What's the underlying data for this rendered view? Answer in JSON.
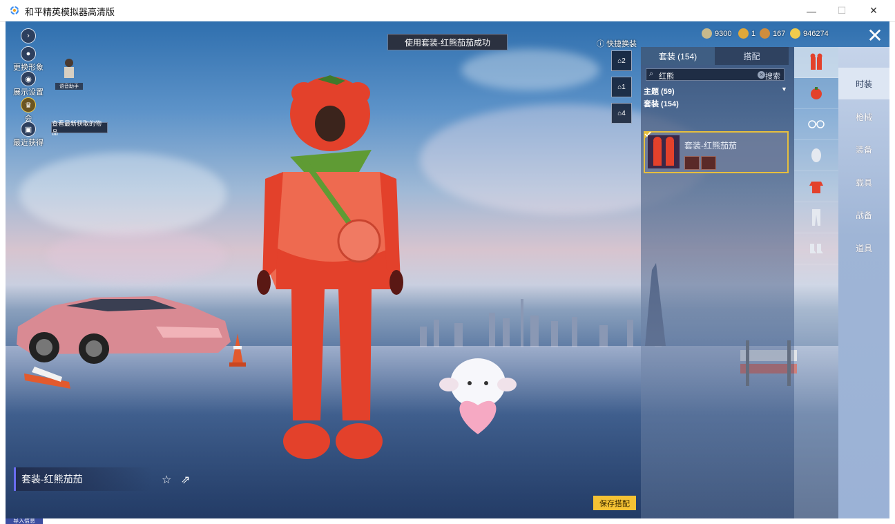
{
  "window": {
    "title": "和平精英模拟器高清版",
    "minimize": "—",
    "maximize": "☐",
    "close": "✕"
  },
  "left_menu": {
    "change_look": "更换形象",
    "display_settings": "展示设置",
    "vip": "会",
    "recent": "最近获得",
    "voice_assistant": "语音助手",
    "tooltip": "查看最新获取的物品"
  },
  "banner": "使用套装-红熊茄茄成功",
  "currencies": [
    {
      "value": "9300",
      "color": "#c7b98c"
    },
    {
      "value": "1",
      "color": "#e0a83a"
    },
    {
      "value": "167",
      "color": "#d08d3c"
    },
    {
      "value": "946274",
      "color": "#f0cb4c"
    }
  ],
  "quick_change": {
    "label": "快捷换装",
    "slots": [
      "2",
      "1",
      "4"
    ]
  },
  "panel": {
    "tabs": [
      {
        "label": "套装 (154)",
        "active": true
      },
      {
        "label": "搭配",
        "active": false
      }
    ],
    "search": {
      "value": "红熊",
      "button": "搜索"
    },
    "categories": {
      "theme": "主题 (59)",
      "suit": "套装 (154)"
    },
    "result": {
      "name": "套装-红熊茄茄"
    }
  },
  "category_icons": [
    "suit-icon",
    "headwear-icon",
    "glasses-icon",
    "mask-icon",
    "top-icon",
    "pants-icon",
    "shoes-icon"
  ],
  "right_menu": [
    {
      "label": "时装",
      "active": true
    },
    {
      "label": "枪械",
      "active": false
    },
    {
      "label": "装备",
      "active": false
    },
    {
      "label": "载具",
      "active": false
    },
    {
      "label": "战备",
      "active": false
    },
    {
      "label": "道具",
      "active": false
    }
  ],
  "bottom": {
    "outfit_name": "套装-红熊茄茄",
    "save": "保存搭配",
    "status_tab": "导入信息"
  },
  "colors": {
    "accent_gold": "#f5c234",
    "selection_border": "#e7bf3d",
    "outfit_red": "#e3412b"
  }
}
